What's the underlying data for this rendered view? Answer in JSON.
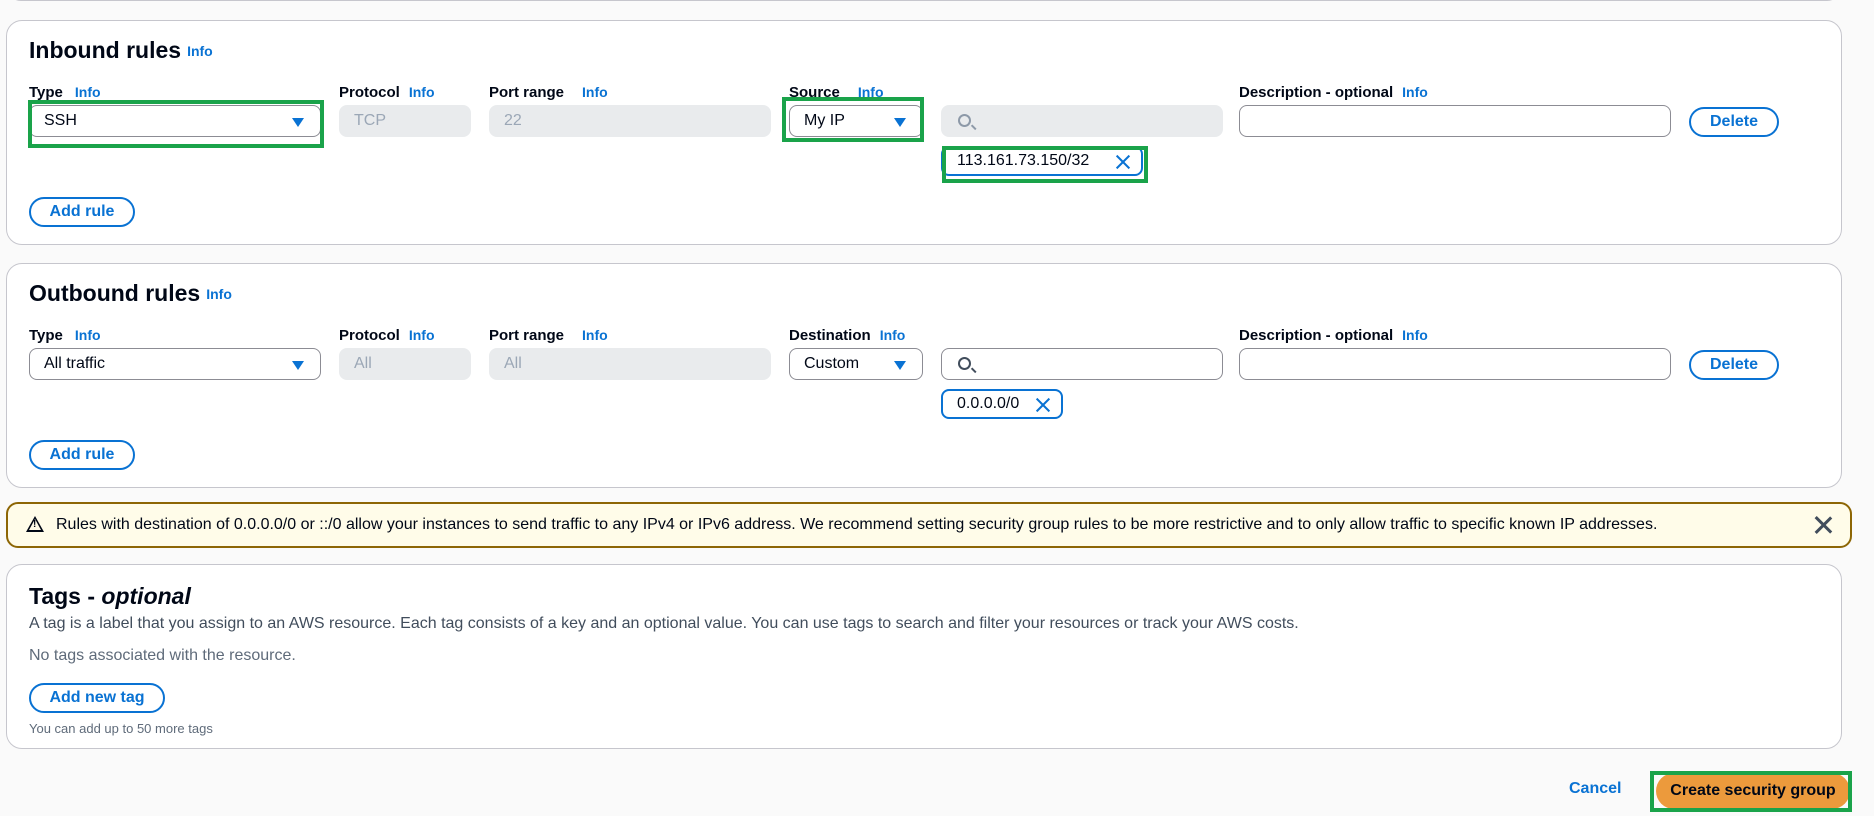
{
  "inbound": {
    "title": "Inbound rules",
    "title_info": "Info",
    "labels": {
      "type": "Type",
      "protocol": "Protocol",
      "port_range": "Port range",
      "source": "Source",
      "description": "Description - optional",
      "info": "Info"
    },
    "rule": {
      "type": "SSH",
      "protocol": "TCP",
      "port_range": "22",
      "source": "My IP",
      "search_value": "",
      "token": "113.161.73.150/32",
      "description": ""
    },
    "delete_label": "Delete",
    "add_rule_label": "Add rule"
  },
  "outbound": {
    "title": "Outbound rules",
    "title_info": "Info",
    "labels": {
      "type": "Type",
      "protocol": "Protocol",
      "port_range": "Port range",
      "destination": "Destination",
      "description": "Description - optional",
      "info": "Info"
    },
    "rule": {
      "type": "All traffic",
      "protocol": "All",
      "port_range": "All",
      "destination": "Custom",
      "search_value": "",
      "token": "0.0.0.0/0",
      "description": ""
    },
    "delete_label": "Delete",
    "add_rule_label": "Add rule"
  },
  "warning": {
    "text": "Rules with destination of 0.0.0.0/0 or ::/0 allow your instances to send traffic to any IPv4 or IPv6 address. We recommend setting security group rules to be more restrictive and to only allow traffic to specific known IP addresses.",
    "icon": "warning-icon"
  },
  "tags": {
    "title": "Tags - ",
    "title_italic": "optional",
    "description": "A tag is a label that you assign to an AWS resource. Each tag consists of a key and an optional value. You can use tags to search and filter your resources or track your AWS costs.",
    "empty_text": "No tags associated with the resource.",
    "add_tag_label": "Add new tag",
    "limit_text": "You can add up to 50 more tags"
  },
  "footer": {
    "cancel_label": "Cancel",
    "create_label": "Create security group"
  },
  "colors": {
    "link": "#0972d3",
    "primary_button": "#ec9a3c",
    "highlight": "#1aa34a",
    "warning_border": "#8d6605",
    "warning_bg": "#fffce9"
  }
}
